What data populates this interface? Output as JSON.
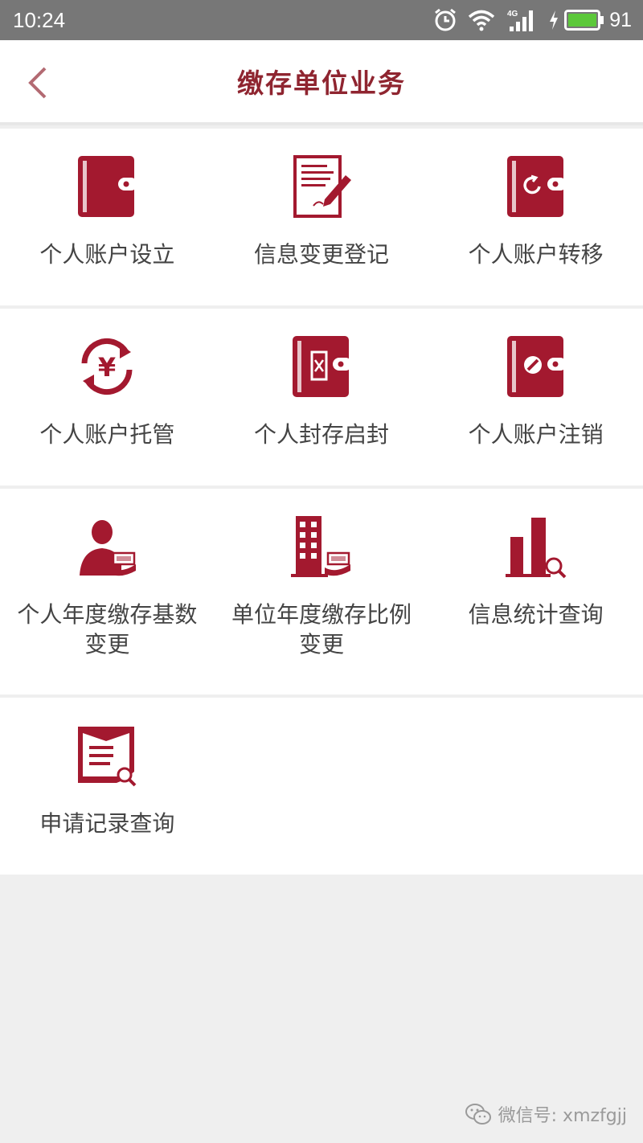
{
  "status_bar": {
    "time": "10:24",
    "network": "4G",
    "battery": "91",
    "icons": [
      "alarm-icon",
      "wifi-icon",
      "signal-icon",
      "charging-icon",
      "battery-icon"
    ]
  },
  "header": {
    "title": "缴存单位业务",
    "back_icon": "chevron-left-icon"
  },
  "menu": {
    "items": [
      {
        "label": "个人账户设立",
        "icon": "wallet-icon"
      },
      {
        "label": "信息变更登记",
        "icon": "document-edit-icon"
      },
      {
        "label": "个人账户转移",
        "icon": "wallet-transfer-icon"
      },
      {
        "label": "个人账户托管",
        "icon": "yuan-cycle-icon"
      },
      {
        "label": "个人封存启封",
        "icon": "wallet-seal-icon"
      },
      {
        "label": "个人账户注销",
        "icon": "wallet-cancel-icon"
      },
      {
        "label": "个人年度缴存基数变更",
        "icon": "person-money-icon"
      },
      {
        "label": "单位年度缴存比例变更",
        "icon": "building-money-icon"
      },
      {
        "label": "信息统计查询",
        "icon": "bar-chart-search-icon"
      },
      {
        "label": "申请记录查询",
        "icon": "record-search-icon"
      }
    ]
  },
  "watermark": {
    "text": "微信号: xmzfgjj"
  },
  "colors": {
    "accent": "#a3192f",
    "title": "#8f2530",
    "status_bar": "#777777",
    "battery": "#5cc83a"
  }
}
